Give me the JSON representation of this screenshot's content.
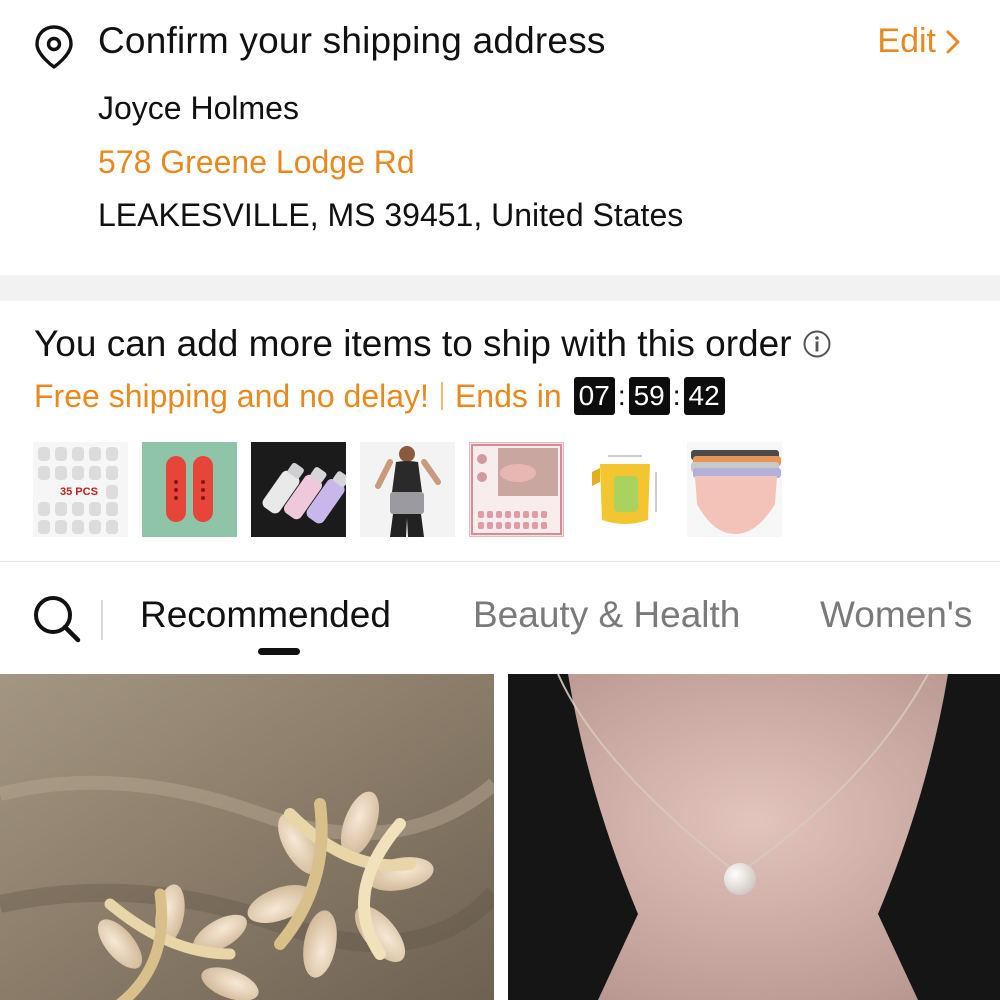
{
  "address": {
    "title": "Confirm your shipping address",
    "edit_label": "Edit",
    "name": "Joyce Holmes",
    "street": "578 Greene Lodge Rd",
    "city_line": "LEAKESVILLE, MS 39451, United States"
  },
  "add_more": {
    "heading": "You can add more items to ship with this order",
    "promo": "Free shipping and no delay!",
    "ends_in": "Ends in",
    "timer": {
      "hours": "07",
      "minutes": "59",
      "seconds": "42"
    },
    "thumbnail_badge": "35 PCS"
  },
  "tabs": [
    {
      "label": "Recommended",
      "active": true
    },
    {
      "label": "Beauty & Health",
      "active": false
    },
    {
      "label": "Women's",
      "active": false
    }
  ],
  "colors": {
    "accent": "#e8891e",
    "timer_bg": "#0d0d0d"
  },
  "icons": [
    "location-pin-icon",
    "chevron-right-icon",
    "info-icon",
    "search-icon"
  ]
}
